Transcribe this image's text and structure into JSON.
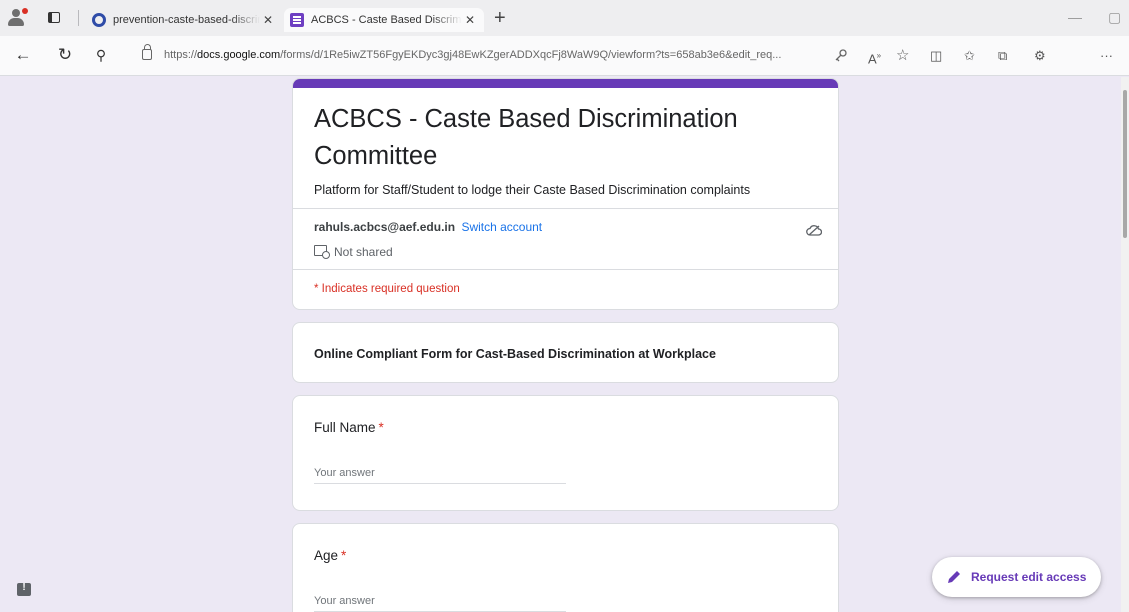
{
  "browser": {
    "tabs": [
      {
        "title": "prevention-caste-based-discrimination",
        "favicon": "ring-icon"
      },
      {
        "title": "ACBCS - Caste Based Discrimination",
        "favicon": "google-forms-icon"
      }
    ],
    "url_prefix": "https://",
    "url_domain": "docs.google.com",
    "url_path": "/forms/d/1Re5iwZT56FgyEKDyc3gj48EwKZgerADDXqcFj8WaW9Q/viewform?ts=658ab3e6&edit_req..."
  },
  "form": {
    "title": "ACBCS - Caste Based Discrimination Committee",
    "description": "Platform for Staff/Student to lodge their Caste Based Discrimination complaints",
    "account_email": "rahuls.acbcs@aef.edu.in",
    "switch_account": "Switch account",
    "not_shared": "Not shared",
    "required_note": "* Indicates required question",
    "section_title": "Online Compliant Form for Cast-Based Discrimination at Workplace",
    "questions": [
      {
        "label": "Full Name",
        "required": "*",
        "placeholder": "Your answer"
      },
      {
        "label": "Age",
        "required": "*",
        "placeholder": "Your answer"
      }
    ],
    "request_edit_access": "Request edit access"
  },
  "colors": {
    "theme": "#673ab7",
    "background": "#ece8f4",
    "required": "#d93025",
    "link": "#1a73e8"
  }
}
